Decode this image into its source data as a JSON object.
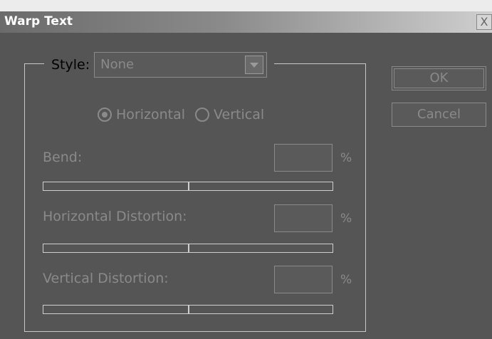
{
  "window": {
    "title": "Warp Text",
    "close_label": "X"
  },
  "style_group": {
    "label": "Style:",
    "selected_value": "None"
  },
  "orientation": {
    "options": [
      {
        "label": "Horizontal",
        "checked": true
      },
      {
        "label": "Vertical",
        "checked": false
      }
    ]
  },
  "sliders": [
    {
      "label": "Bend:",
      "value": "",
      "unit": "%"
    },
    {
      "label": "Horizontal Distortion:",
      "value": "",
      "unit": "%"
    },
    {
      "label": "Vertical Distortion:",
      "value": "",
      "unit": "%"
    }
  ],
  "buttons": {
    "ok_label": "OK",
    "cancel_label": "Cancel"
  },
  "colors": {
    "background": "#555555",
    "disabled_text": "#8a8a8a",
    "title_text": "#ffffff"
  },
  "icons": {
    "dropdown": "chevron-down-icon",
    "close": "close-icon"
  }
}
